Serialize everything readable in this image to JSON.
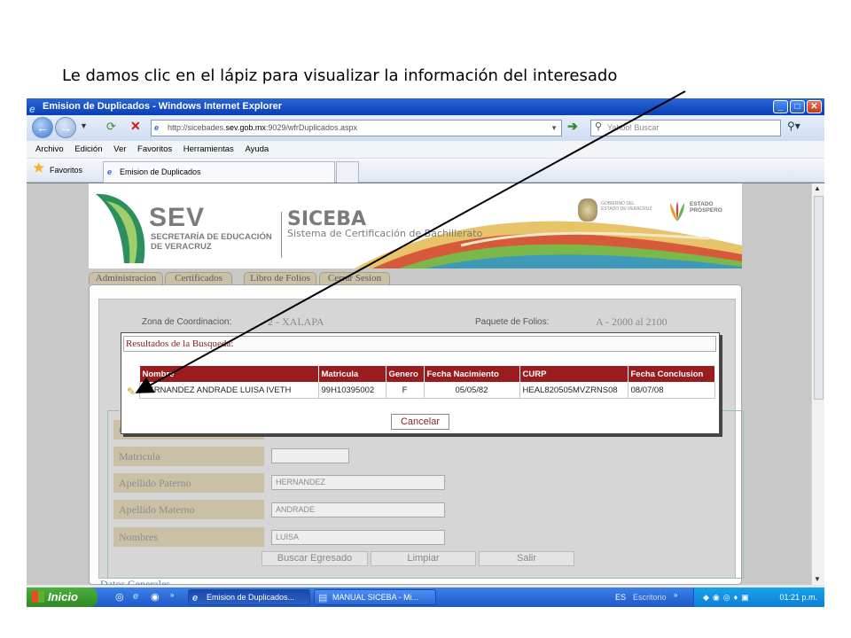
{
  "caption": "Le damos clic en el lápiz para visualizar la información del interesado",
  "window": {
    "title": "Emision de Duplicados - Windows Internet Explorer",
    "controls": {
      "minimize": "_",
      "maximize": "□",
      "close": "✕"
    }
  },
  "address": {
    "prefix": "http://sicebades.",
    "domain": "sev.gob.mx",
    "suffix": ":9029/wfrDuplicados.aspx"
  },
  "search": {
    "placeholder": "Yahoo! Buscar"
  },
  "menu": [
    "Archivo",
    "Edición",
    "Ver",
    "Favoritos",
    "Herramientas",
    "Ayuda"
  ],
  "favorites_label": "Favoritos",
  "tab_title": "Emision de Duplicados",
  "header": {
    "sev": "SEV",
    "sev_line1": "SECRETARÍA DE EDUCACIÓN",
    "sev_line2": "DE VERACRUZ",
    "siceba": "SICEBA",
    "siceba_sub": "Sistema de Certificación de Bachillerato",
    "gob_line1": "GOBIERNO DEL",
    "gob_line2": "ESTADO DE VERACRUZ",
    "estado_line1": "ESTADO",
    "estado_line2": "PRÓSPERO"
  },
  "nav_tabs": [
    "Administracion",
    "Certificados",
    "Libro de Folios",
    "Cerrar Sesion"
  ],
  "form": {
    "zona_label": "Zona de Coordinacion:",
    "zona_value": "2 - XALAPA",
    "paquete_label": "Paquete de Folios:",
    "paquete_value": "A - 2000 al 2100",
    "fieldset_legend": "Bu",
    "curp_label": "CU",
    "fields": [
      {
        "label": "Matricula",
        "value": ""
      },
      {
        "label": "Apellido Paterno",
        "value": "HERNANDEZ"
      },
      {
        "label": "Apellido Materno",
        "value": "ANDRADE"
      },
      {
        "label": "Nombres",
        "value": "LUISA"
      }
    ],
    "buttons": [
      "Buscar Egresado",
      "Limpiar",
      "Salir"
    ],
    "next_section": "Datos Generales"
  },
  "dialog": {
    "title": "Resultados de la Busqueda",
    "colon": ":",
    "columns": [
      "Nombre",
      "Matricula",
      "Genero",
      "Fecha Nacimiento",
      "CURP",
      "Fecha Conclusion"
    ],
    "rows": [
      [
        "HERNANDEZ ANDRADE LUISA IVETH",
        "99H10395002",
        "F",
        "05/05/82",
        "HEAL820505MVZRNS08",
        "08/07/08"
      ]
    ],
    "cancel_label": "Cancelar"
  },
  "taskbar": {
    "start": "Inicio",
    "items": [
      "Emision de Duplicados...",
      "MANUAL SICEBA - Mi..."
    ],
    "lang": "ES",
    "desktop": "Escritorio",
    "clock": "01:21 p.m."
  }
}
